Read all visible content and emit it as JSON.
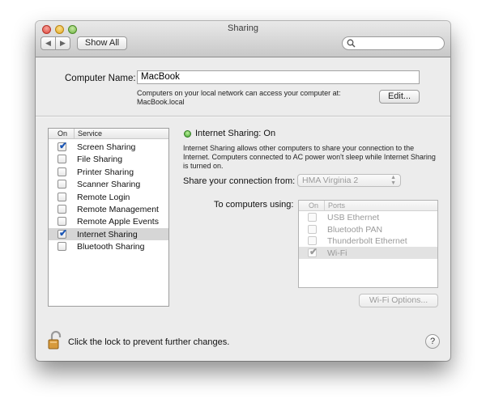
{
  "window": {
    "title": "Sharing",
    "show_all_label": "Show All",
    "search_placeholder": ""
  },
  "computer_name": {
    "label": "Computer Name:",
    "value": "MacBook",
    "description_line1": "Computers on your local network can access your computer at:",
    "description_line2": "MacBook.local",
    "edit_label": "Edit..."
  },
  "services": {
    "header_on": "On",
    "header_service": "Service",
    "items": [
      {
        "label": "Screen Sharing",
        "on": true,
        "selected": false
      },
      {
        "label": "File Sharing",
        "on": false,
        "selected": false
      },
      {
        "label": "Printer Sharing",
        "on": false,
        "selected": false
      },
      {
        "label": "Scanner Sharing",
        "on": false,
        "selected": false
      },
      {
        "label": "Remote Login",
        "on": false,
        "selected": false
      },
      {
        "label": "Remote Management",
        "on": false,
        "selected": false
      },
      {
        "label": "Remote Apple Events",
        "on": false,
        "selected": false
      },
      {
        "label": "Internet Sharing",
        "on": true,
        "selected": true
      },
      {
        "label": "Bluetooth Sharing",
        "on": false,
        "selected": false
      }
    ]
  },
  "detail": {
    "status_title": "Internet Sharing: On",
    "status_color": "#3fa42c",
    "description": "Internet Sharing allows other computers to share your connection to the Internet. Computers connected to AC power won't sleep while Internet Sharing is turned on.",
    "share_from_label": "Share your connection from:",
    "share_from_value": "HMA Virginia 2",
    "to_computers_label": "To computers using:",
    "ports_header_on": "On",
    "ports_header_ports": "Ports",
    "ports": [
      {
        "label": "USB Ethernet",
        "on": false,
        "selected": false
      },
      {
        "label": "Bluetooth PAN",
        "on": false,
        "selected": false
      },
      {
        "label": "Thunderbolt Ethernet",
        "on": false,
        "selected": false
      },
      {
        "label": "Wi-Fi",
        "on": true,
        "selected": true
      }
    ],
    "wifi_options_label": "Wi-Fi Options..."
  },
  "footer": {
    "lock_text": "Click the lock to prevent further changes.",
    "help_label": "?"
  }
}
